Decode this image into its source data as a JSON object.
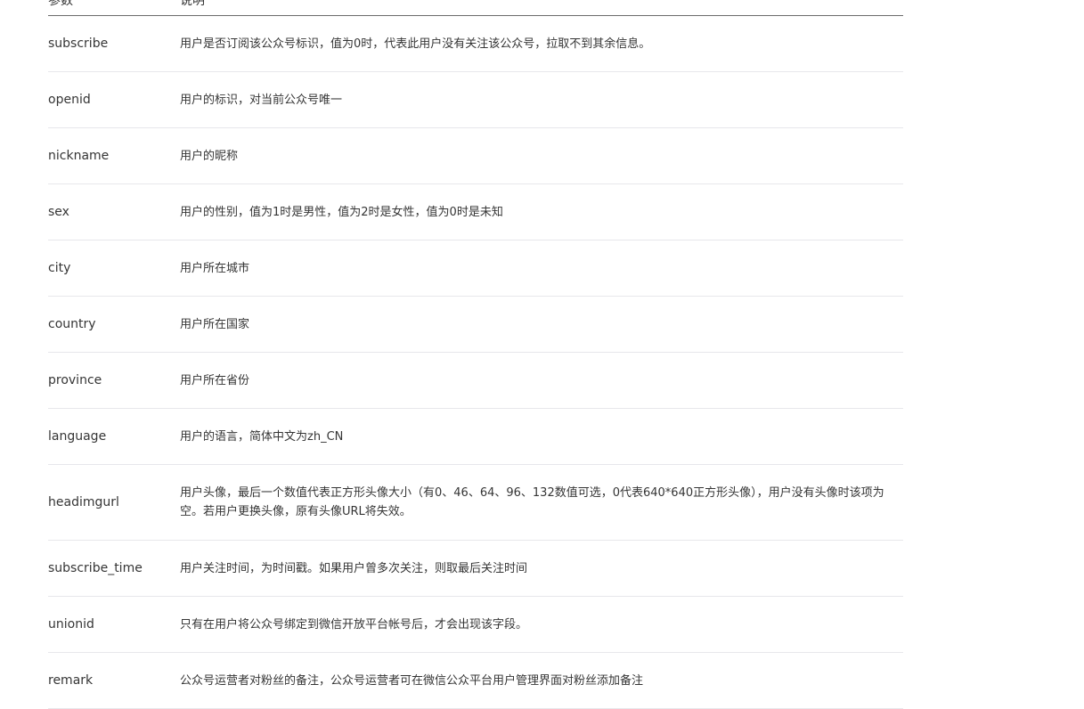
{
  "table": {
    "headers": [
      "参数",
      "说明"
    ],
    "rows": [
      {
        "name": "subscribe",
        "desc": "用户是否订阅该公众号标识，值为0时，代表此用户没有关注该公众号，拉取不到其余信息。"
      },
      {
        "name": "openid",
        "desc": "用户的标识，对当前公众号唯一"
      },
      {
        "name": "nickname",
        "desc": "用户的昵称"
      },
      {
        "name": "sex",
        "desc": "用户的性别，值为1时是男性，值为2时是女性，值为0时是未知"
      },
      {
        "name": "city",
        "desc": "用户所在城市"
      },
      {
        "name": "country",
        "desc": "用户所在国家"
      },
      {
        "name": "province",
        "desc": "用户所在省份"
      },
      {
        "name": "language",
        "desc": "用户的语言，简体中文为zh_CN"
      },
      {
        "name": "headimgurl",
        "desc": "用户头像，最后一个数值代表正方形头像大小（有0、46、64、96、132数值可选，0代表640*640正方形头像），用户没有头像时该项为空。若用户更换头像，原有头像URL将失效。"
      },
      {
        "name": "subscribe_time",
        "desc": "用户关注时间，为时间戳。如果用户曾多次关注，则取最后关注时间"
      },
      {
        "name": "unionid",
        "desc": "只有在用户将公众号绑定到微信开放平台帐号后，才会出现该字段。"
      },
      {
        "name": "remark",
        "desc": "公众号运营者对粉丝的备注，公众号运营者可在微信公众平台用户管理界面对粉丝添加备注"
      }
    ]
  }
}
